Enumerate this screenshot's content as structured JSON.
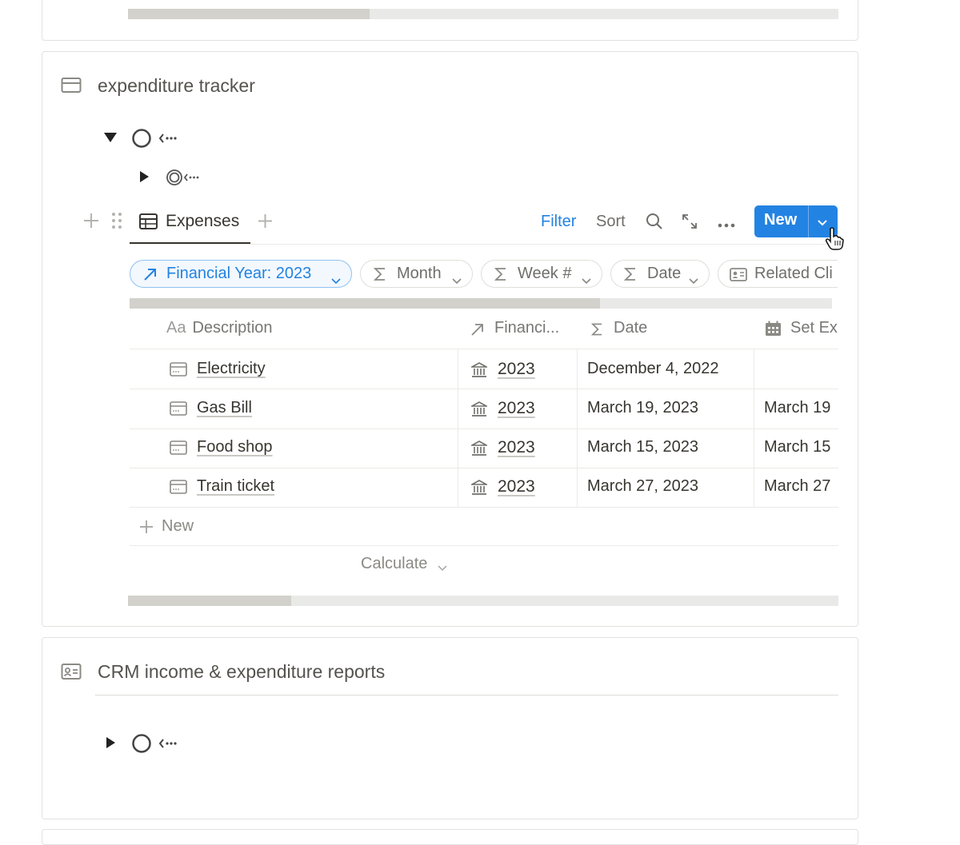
{
  "top_card": {
    "scroll_progress": 0.34
  },
  "expenditure_card": {
    "title": "expenditure tracker",
    "view_tab": "Expenses",
    "toolbar": {
      "filter_label": "Filter",
      "sort_label": "Sort",
      "new_label": "New"
    },
    "filter_chips": [
      {
        "label": "Financial Year: 2023",
        "active": true
      },
      {
        "label": "Month",
        "active": false
      },
      {
        "label": "Week #",
        "active": false
      },
      {
        "label": "Date",
        "active": false
      },
      {
        "label": "Related Cli",
        "active": false
      }
    ],
    "chips_scroll_progress": 0.67,
    "table": {
      "columns": [
        {
          "prefix": "Aa",
          "label": "Description"
        },
        {
          "prefix": "",
          "label": "Financi..."
        },
        {
          "prefix": "",
          "label": "Date"
        },
        {
          "prefix": "",
          "label": "Set Ex"
        }
      ],
      "rows": [
        {
          "description": "Electricity",
          "financial_year": "2023",
          "date": "December 4, 2022",
          "set_ex": ""
        },
        {
          "description": "Gas Bill",
          "financial_year": "2023",
          "date": "March 19, 2023",
          "set_ex": "March 19"
        },
        {
          "description": "Food shop",
          "financial_year": "2023",
          "date": "March 15, 2023",
          "set_ex": "March 15"
        },
        {
          "description": "Train ticket",
          "financial_year": "2023",
          "date": "March 27, 2023",
          "set_ex": "March 27"
        }
      ],
      "new_row_label": "New",
      "calculate_label": "Calculate"
    },
    "table_scroll_progress": 0.23
  },
  "crm_card": {
    "title": "CRM income & expenditure reports"
  },
  "colors": {
    "accent": "#2383e2",
    "text": "#37352f",
    "muted": "#787774",
    "border": "#e3e2df"
  }
}
